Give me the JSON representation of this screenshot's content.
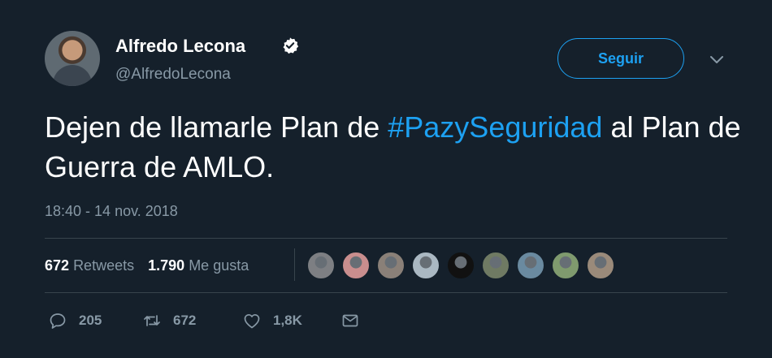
{
  "user": {
    "name": "Alfredo Lecona",
    "handle": "@AlfredoLecona"
  },
  "follow_button": {
    "label": "Seguir"
  },
  "tweet": {
    "text_before": "Dejen de llamarle Plan de ",
    "hashtag": "#PazySeguridad",
    "text_after": " al Plan de Guerra de AMLO.",
    "timestamp": "18:40 - 14 nov. 2018"
  },
  "stats": {
    "retweets_count": "672",
    "retweets_label": "Retweets",
    "likes_count": "1.790",
    "likes_label": "Me gusta"
  },
  "liked_by_avatar_colors": [
    "#7d7f83",
    "#c98e8e",
    "#8a8078",
    "#aab8c2",
    "#111111",
    "#6f7a63",
    "#6a8aa0",
    "#7f9a6e",
    "#9a8a7a"
  ],
  "actions": {
    "replies": "205",
    "retweets": "672",
    "likes": "1,8K"
  },
  "colors": {
    "background": "#15202b",
    "accent": "#1da1f2",
    "secondary_text": "#8899a6"
  }
}
